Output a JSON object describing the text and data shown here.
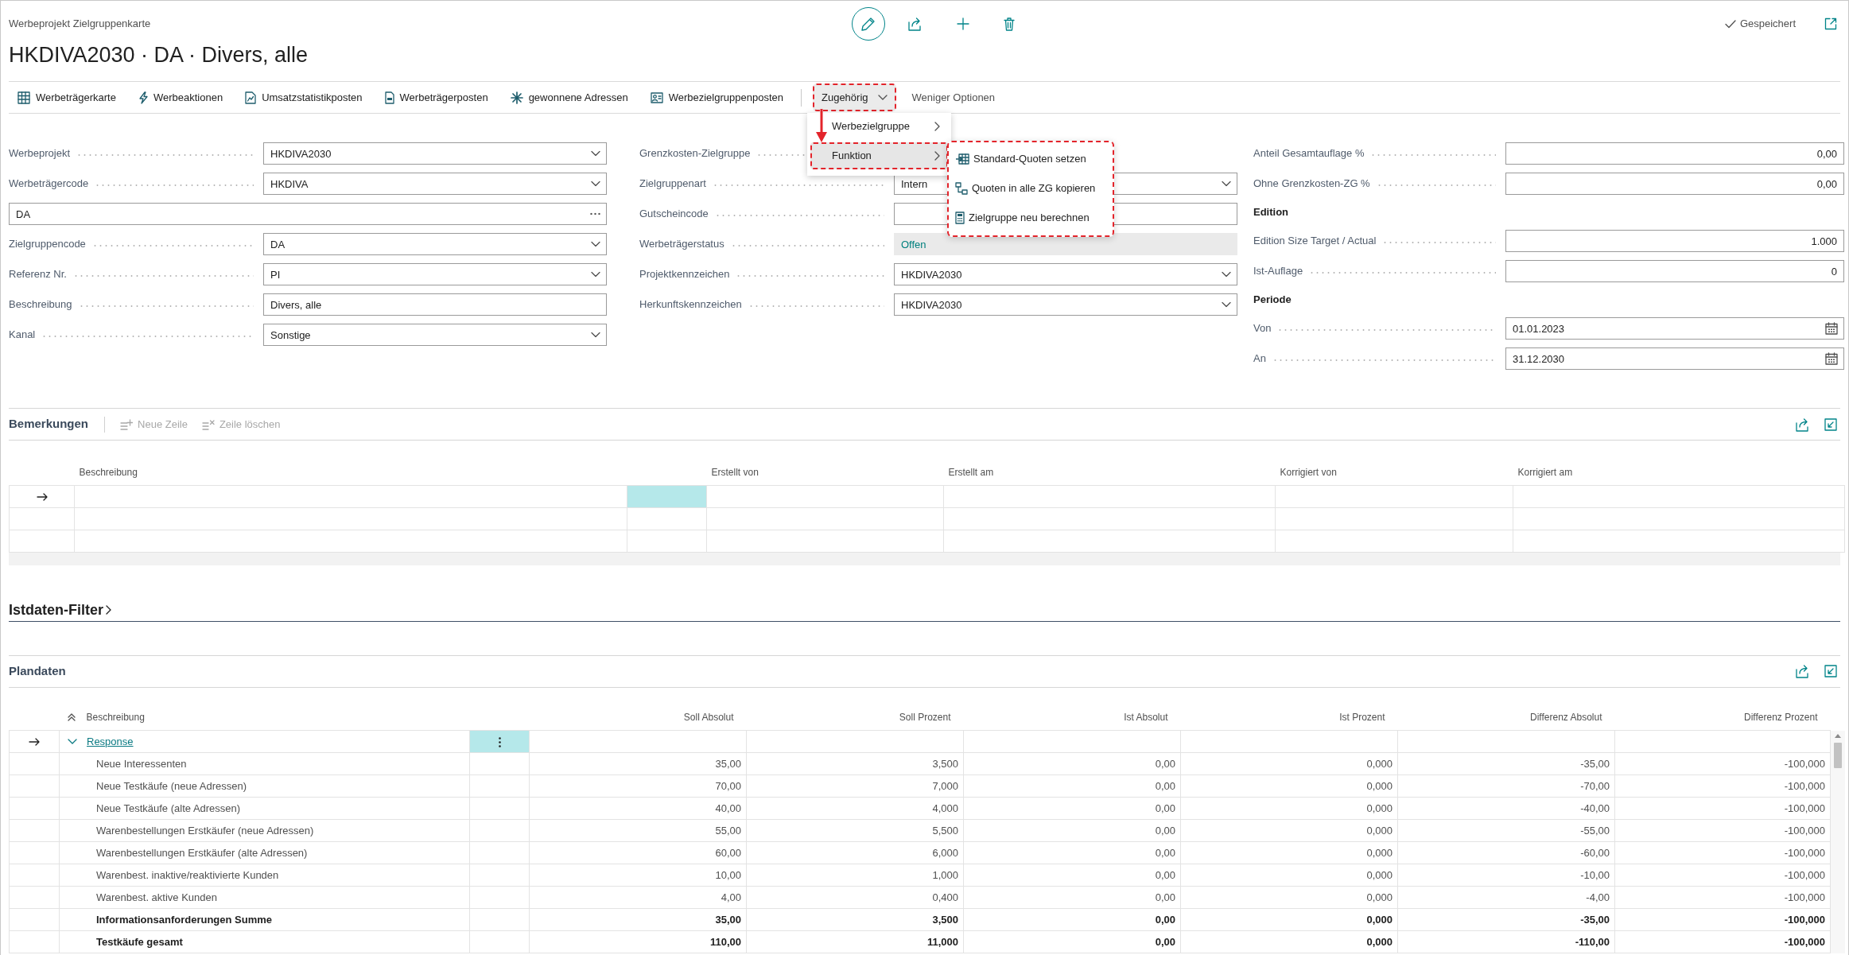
{
  "page": {
    "caption": "Werbeprojekt Zielgruppenkarte",
    "title": "HKDIVA2030 · DA · Divers, alle",
    "save_status": "Gespeichert"
  },
  "actions": [
    {
      "kind": "action",
      "label": "Werbeträgerkarte",
      "highlighted": false
    },
    {
      "kind": "action",
      "label": "Werbeaktionen",
      "highlighted": false
    },
    {
      "kind": "action",
      "label": "Umsatzstatistikposten",
      "highlighted": false
    },
    {
      "kind": "action",
      "label": "Werbeträgerposten",
      "highlighted": false
    },
    {
      "kind": "action",
      "label": "gewonnene Adressen",
      "highlighted": false
    },
    {
      "kind": "action",
      "label": "Werbezielgruppenposten",
      "highlighted": false
    },
    {
      "kind": "menu",
      "label": "Zugehörig",
      "expanded": true,
      "highlighted": true,
      "menu": [
        {
          "kind": "submenu",
          "label": "Werbezielgruppe",
          "selected": false,
          "highlighted": false
        },
        {
          "kind": "submenu",
          "label": "Funktion",
          "selected": true,
          "highlighted": true,
          "submenu": {
            "highlighted": true,
            "items": [
              {
                "label": "Standard-Quoten setzen"
              },
              {
                "label": "Quoten in alle ZG kopieren"
              },
              {
                "label": "Zielgruppe neu berechnen"
              }
            ]
          }
        }
      ]
    },
    {
      "kind": "link",
      "label": "Weniger Optionen",
      "highlighted": false
    }
  ],
  "form": {
    "columns": [
      {
        "fields": [
          {
            "kind": "dropdown",
            "label": "Werbeprojekt",
            "value": "HKDIVA2030"
          },
          {
            "kind": "dropdown",
            "label": "Werbeträgercode",
            "value": "HKDIVA"
          },
          {
            "kind": "lookup",
            "value": "DA"
          },
          {
            "kind": "dropdown",
            "label": "Zielgruppencode",
            "value": "DA"
          },
          {
            "kind": "dropdown",
            "label": "Referenz Nr.",
            "value": "PI"
          },
          {
            "kind": "text",
            "label": "Beschreibung",
            "value": "Divers, alle"
          },
          {
            "kind": "dropdown",
            "label": "Kanal",
            "value": "Sonstige"
          }
        ]
      },
      {
        "fields": [
          {
            "kind": "label",
            "label": "Grenzkosten-Zielgruppe"
          },
          {
            "kind": "dropdown",
            "label": "Zielgruppenart",
            "value": "Intern"
          },
          {
            "kind": "text",
            "label": "Gutscheincode"
          },
          {
            "kind": "readonly",
            "label": "Werbeträgerstatus",
            "value": "Offen"
          },
          {
            "kind": "dropdown",
            "label": "Projektkennzeichen",
            "value": "HKDIVA2030"
          },
          {
            "kind": "dropdown",
            "label": "Herkunftskennzeichen",
            "value": "HKDIVA2030"
          }
        ]
      },
      {
        "fields": [
          {
            "kind": "number",
            "label": "Anteil Gesamtauflage %",
            "value": "0,00"
          },
          {
            "kind": "number",
            "label": "Ohne Grenzkosten-ZG %",
            "value": "0,00"
          },
          {
            "kind": "heading",
            "label": "Edition"
          },
          {
            "kind": "number",
            "label": "Edition Size Target / Actual",
            "value": "1.000"
          },
          {
            "kind": "number",
            "label": "Ist-Auflage",
            "value": "0"
          },
          {
            "kind": "heading",
            "label": "Periode"
          },
          {
            "kind": "date",
            "label": "Von",
            "value": "01.01.2023"
          },
          {
            "kind": "date",
            "label": "An",
            "value": "31.12.2030"
          }
        ]
      }
    ]
  },
  "remarks": {
    "title": "Bemerkungen",
    "actions": [
      {
        "label": "Neue Zeile",
        "disabled": true
      },
      {
        "label": "Zeile löschen",
        "disabled": true
      }
    ],
    "columns": [
      {
        "kind": "text",
        "label": "Beschreibung"
      },
      {
        "kind": "blank"
      },
      {
        "kind": "text",
        "label": "Erstellt von"
      },
      {
        "kind": "text",
        "label": "Erstellt am"
      },
      {
        "kind": "text",
        "label": "Korrigiert von"
      },
      {
        "kind": "text",
        "label": "Korrigiert am"
      }
    ],
    "rows": [
      {
        "selected": true
      },
      {
        "selected": false
      },
      {
        "selected": false
      }
    ]
  },
  "filter": {
    "title": "Istdaten-Filter",
    "expanded": false
  },
  "plan": {
    "title": "Plandaten",
    "columns": [
      {
        "kind": "text",
        "label": "Beschreibung"
      },
      {
        "kind": "blank"
      },
      {
        "kind": "number",
        "label": "Soll Absolut"
      },
      {
        "kind": "number",
        "label": "Soll Prozent"
      },
      {
        "kind": "number",
        "label": "Ist Absolut"
      },
      {
        "kind": "number",
        "label": "Ist Prozent"
      },
      {
        "kind": "number",
        "label": "Differenz Absolut"
      },
      {
        "kind": "number",
        "label": "Differenz Prozent"
      }
    ],
    "rows": [
      {
        "kind": "group",
        "label": "Response",
        "expanded": true,
        "selected": true,
        "children": [
          {
            "kind": "item",
            "label": "Neue Interessenten",
            "selected": false,
            "values": [
              "35,00",
              "3,500",
              "0,00",
              "0,000",
              "-35,00",
              "-100,000"
            ]
          },
          {
            "kind": "item",
            "label": "Neue Testkäufe (neue Adressen)",
            "selected": false,
            "values": [
              "70,00",
              "7,000",
              "0,00",
              "0,000",
              "-70,00",
              "-100,000"
            ]
          },
          {
            "kind": "item",
            "label": "Neue Testkäufe (alte Adressen)",
            "selected": false,
            "values": [
              "40,00",
              "4,000",
              "0,00",
              "0,000",
              "-40,00",
              "-100,000"
            ]
          },
          {
            "kind": "item",
            "label": "Warenbestellungen Erstkäufer (neue Adressen)",
            "selected": false,
            "values": [
              "55,00",
              "5,500",
              "0,00",
              "0,000",
              "-55,00",
              "-100,000"
            ]
          },
          {
            "kind": "item",
            "label": "Warenbestellungen Erstkäufer (alte Adressen)",
            "selected": false,
            "values": [
              "60,00",
              "6,000",
              "0,00",
              "0,000",
              "-60,00",
              "-100,000"
            ]
          },
          {
            "kind": "item",
            "label": "Warenbest. inaktive/reaktivierte Kunden",
            "selected": false,
            "values": [
              "10,00",
              "1,000",
              "0,00",
              "0,000",
              "-10,00",
              "-100,000"
            ]
          },
          {
            "kind": "item",
            "label": "Warenbest. aktive Kunden",
            "selected": false,
            "values": [
              "4,00",
              "0,400",
              "0,00",
              "0,000",
              "-4,00",
              "-100,000"
            ]
          },
          {
            "kind": "total",
            "label": "Informationsanforderungen Summe",
            "selected": false,
            "values": [
              "35,00",
              "3,500",
              "0,00",
              "0,000",
              "-35,00",
              "-100,000"
            ]
          },
          {
            "kind": "total",
            "label": "Testkäufe gesamt",
            "selected": false,
            "values": [
              "110,00",
              "11,000",
              "0,00",
              "0,000",
              "-110,00",
              "-100,000"
            ]
          }
        ]
      }
    ]
  }
}
